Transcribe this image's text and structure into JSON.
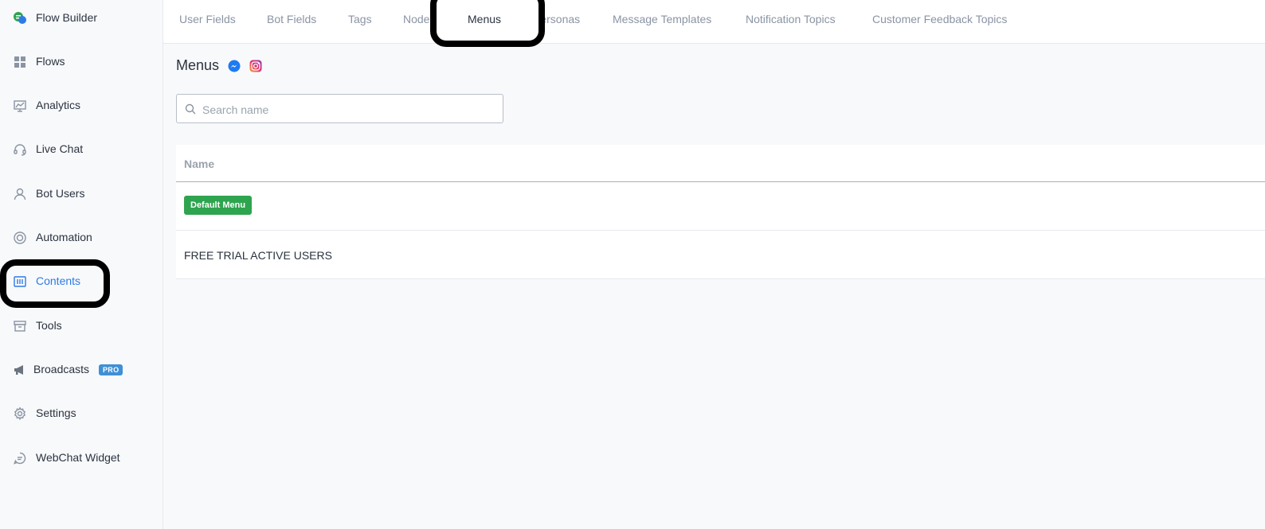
{
  "sidebar": {
    "items": [
      {
        "label": "Flow Builder",
        "icon": "flow-builder-icon",
        "active": false
      },
      {
        "label": "Flows",
        "icon": "grid-icon",
        "active": false
      },
      {
        "label": "Analytics",
        "icon": "analytics-icon",
        "active": false
      },
      {
        "label": "Live Chat",
        "icon": "headset-icon",
        "active": false
      },
      {
        "label": "Bot Users",
        "icon": "user-icon",
        "active": false
      },
      {
        "label": "Automation",
        "icon": "lifebuoy-icon",
        "active": false
      },
      {
        "label": "Contents",
        "icon": "contents-icon",
        "active": true
      },
      {
        "label": "Tools",
        "icon": "archive-box-icon",
        "active": false
      },
      {
        "label": "Broadcasts",
        "icon": "megaphone-icon",
        "active": false,
        "badge": "PRO"
      },
      {
        "label": "Settings",
        "icon": "gear-icon",
        "active": false
      },
      {
        "label": "WebChat Widget",
        "icon": "chat-bubble-icon",
        "active": false
      }
    ]
  },
  "tabs": [
    {
      "label": "User Fields",
      "active": false
    },
    {
      "label": "Bot Fields",
      "active": false
    },
    {
      "label": "Tags",
      "active": false
    },
    {
      "label": "Node",
      "active": false
    },
    {
      "label": "Menus",
      "active": true
    },
    {
      "label": "Personas",
      "active": false
    },
    {
      "label": "Message Templates",
      "active": false
    },
    {
      "label": "Notification Topics",
      "active": false
    },
    {
      "label": "Customer Feedback Topics",
      "active": false
    }
  ],
  "page": {
    "title": "Menus",
    "platform_icons": [
      "messenger-icon",
      "instagram-icon"
    ]
  },
  "search": {
    "placeholder": "Search name",
    "value": ""
  },
  "table": {
    "header": "Name",
    "rows": [
      {
        "badge": "Default Menu"
      },
      {
        "name": "FREE TRIAL ACTIVE USERS"
      }
    ]
  },
  "colors": {
    "accent": "#2d7be5",
    "success": "#2ea44f",
    "pro_badge": "#3f90d6",
    "highlight": "#000000"
  }
}
